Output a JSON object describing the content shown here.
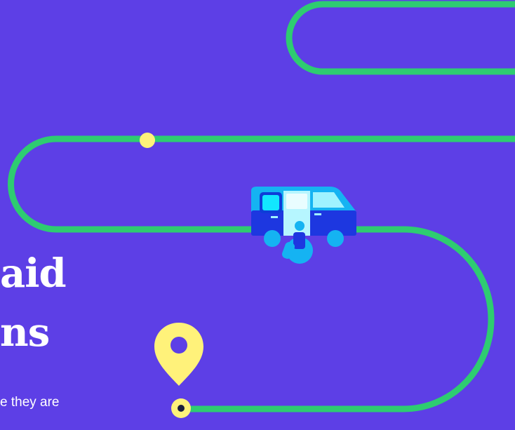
{
  "hero": {
    "heading_line_1": "aid",
    "heading_line_2": "ns",
    "body_fragment": "e they are"
  },
  "colors": {
    "background": "#5d3fe6",
    "route": "#2ecc71",
    "marker": "#fff27a",
    "van_body_dark": "#1d37e0",
    "van_body_light": "#15b3f2",
    "van_window": "#0ff0ff"
  },
  "icons": {
    "van": "accessible-van-icon",
    "wheelchair": "wheelchair-user-icon",
    "pin": "location-pin-icon",
    "start": "route-start-dot-icon",
    "waypoint": "route-waypoint-dot-icon"
  }
}
